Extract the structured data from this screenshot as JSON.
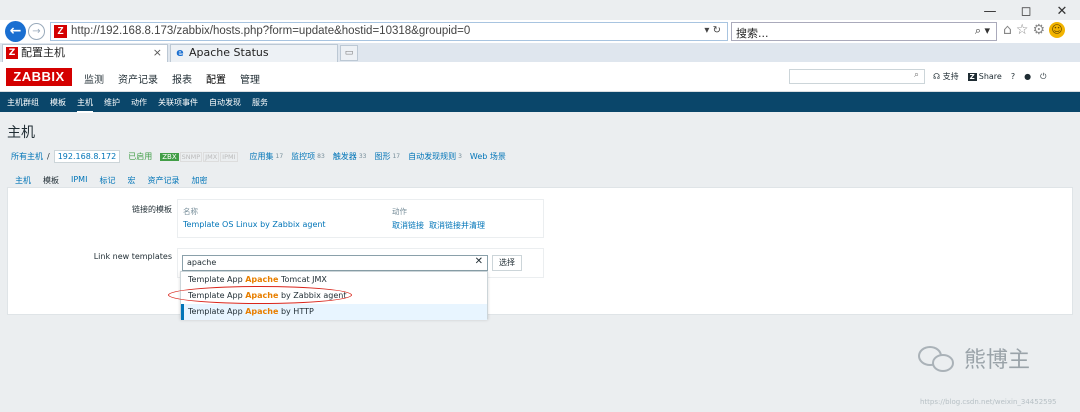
{
  "browser": {
    "window_controls": [
      "—",
      "◻",
      "✕"
    ],
    "url": "http://192.168.8.173/zabbix/hosts.php?form=update&hostid=10318&groupid=0",
    "url_controls": "▾ ↻",
    "search_placeholder": "搜索...",
    "search_icon": "⌕ ▾",
    "tabs": [
      {
        "label": "配置主机",
        "close": "×",
        "icon": "Z"
      },
      {
        "label": "Apache Status",
        "icon": "e"
      }
    ],
    "new_tab_icon": "▭"
  },
  "zabbix": {
    "logo": "ZABBIX",
    "main_menu": [
      "监测",
      "资产记录",
      "报表",
      "配置",
      "管理"
    ],
    "main_menu_selected": "配置",
    "support": "支持",
    "share": "Share",
    "help": "?",
    "sub_menu": [
      "主机群组",
      "模板",
      "主机",
      "维护",
      "动作",
      "关联项事件",
      "自动发现",
      "服务"
    ],
    "sub_menu_selected": "主机",
    "page_title": "主机",
    "breadcrumb": {
      "all_hosts": "所有主机",
      "sep": "/",
      "host": "192.168.8.172",
      "status": "已启用",
      "availability": [
        "ZBX",
        "SNMP",
        "JMX",
        "IPMI"
      ],
      "links": [
        {
          "label": "应用集",
          "count": "17"
        },
        {
          "label": "监控项",
          "count": "83"
        },
        {
          "label": "触发器",
          "count": "33"
        },
        {
          "label": "图形",
          "count": "17"
        },
        {
          "label": "自动发现规则",
          "count": "3"
        },
        {
          "label": "Web 场景",
          "count": ""
        }
      ]
    },
    "form_tabs": [
      "主机",
      "模板",
      "IPMI",
      "标记",
      "宏",
      "资产记录",
      "加密"
    ],
    "form_tab_selected": "模板",
    "linked_templates_label": "链接的模板",
    "table_header_name": "名称",
    "table_header_action": "动作",
    "linked_template_name": "Template OS Linux by Zabbix agent",
    "unlink": "取消链接",
    "unlink_clear": "取消链接并清理",
    "link_new_label": "Link new templates",
    "search_value": "apache",
    "clear_x": "✕",
    "select_button": "选择",
    "suggestions": [
      {
        "pre": "Template App ",
        "hl": "Apache",
        "post": " Tomcat JMX"
      },
      {
        "pre": "Template App ",
        "hl": "Apache",
        "post": " by Zabbix agent"
      },
      {
        "pre": "Template App ",
        "hl": "Apache",
        "post": " by HTTP"
      }
    ]
  },
  "watermark": {
    "name": "熊博主",
    "url": "https://blog.csdn.net/weixin_34452595"
  },
  "colors": {
    "zabbix_red": "#d40000",
    "nav_blue": "#0a466a",
    "link_blue": "#0275b8",
    "enabled_green": "#429e47",
    "highlight_orange": "#e87f00",
    "annotation_red": "#d9261c"
  }
}
